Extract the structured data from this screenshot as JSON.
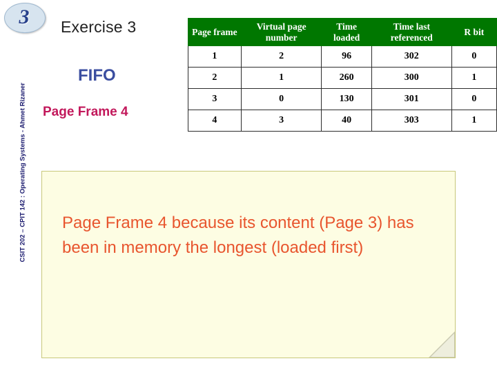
{
  "sidebar": {
    "logo_text": "3",
    "credit": "CSIT 202 – CPIT 142 : Operating Systems - Ahmet Rizaner"
  },
  "slide": {
    "title": "Exercise 3",
    "fifo_label": "FIFO",
    "page_frame_label": "Page Frame 4",
    "answer_text": "Page Frame 4 because its content (Page 3) has been in memory the longest (loaded first)"
  },
  "table": {
    "headers": [
      "Page frame",
      "Virtual page number",
      "Time loaded",
      "Time last referenced",
      "R bit"
    ],
    "rows": [
      [
        "1",
        "2",
        "96",
        "302",
        "0"
      ],
      [
        "2",
        "1",
        "260",
        "300",
        "1"
      ],
      [
        "3",
        "0",
        "130",
        "301",
        "0"
      ],
      [
        "4",
        "3",
        "40",
        "303",
        "1"
      ]
    ]
  },
  "colors": {
    "header_green": "#007700",
    "answer_orange": "#e8552e",
    "fifo_blue": "#3b4ea0",
    "pageframe_pink": "#c2185b",
    "box_yellow": "#fdfde3"
  }
}
